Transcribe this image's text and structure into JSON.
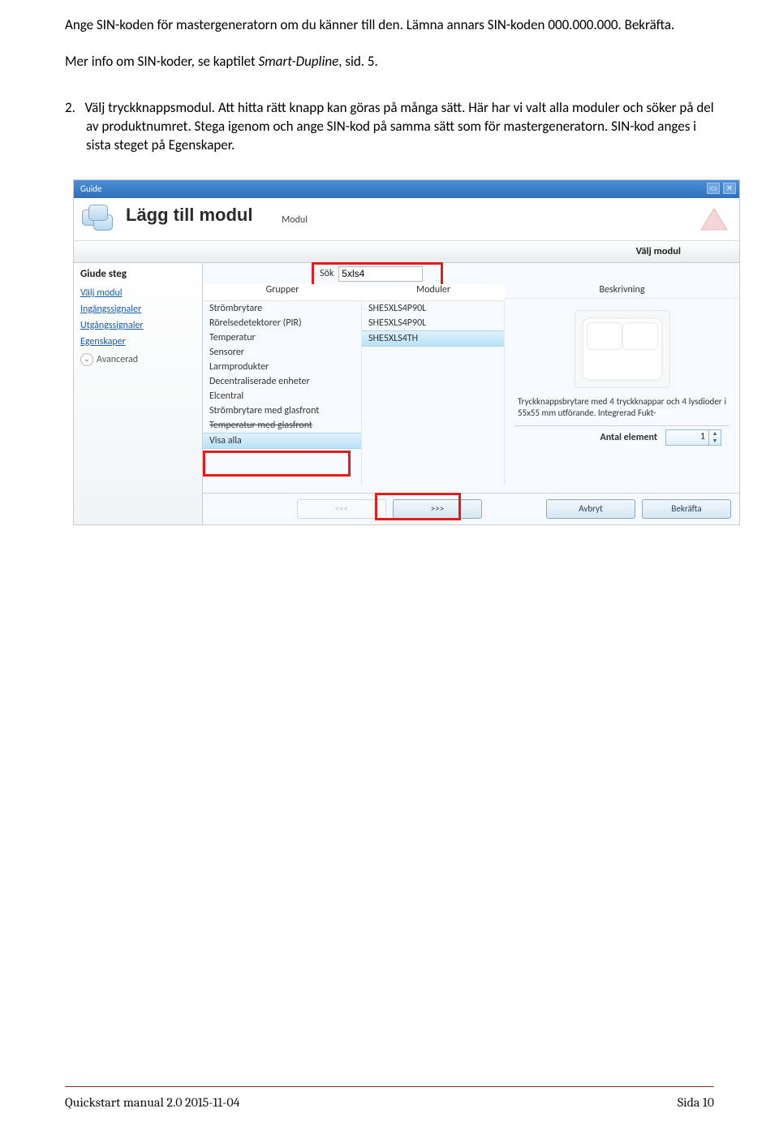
{
  "doc": {
    "p1": "Ange SIN-koden för mastergeneratorn om du känner till den. Lämna annars SIN-koden 000.000.000. Bekräfta.",
    "p2a": "Mer info om SIN-koder, se kaptilet ",
    "p2_italic": "Smart-Dupline",
    "p2b": ", sid. 5.",
    "list_num": "2.",
    "list_text": "Välj tryckknappsmodul. Att hitta rätt knapp kan göras på många sätt. Här har vi valt alla moduler och söker på del av produktnumret. Stega igenom och ange SIN-kod på samma sätt som för mastergeneratorn. SIN-kod anges i sista steget på Egenskaper."
  },
  "shot": {
    "titlebar": "Guide",
    "big_title": "Lägg till modul",
    "sub": "Modul",
    "banner": "Välj modul",
    "sidebar": {
      "title": "Giude steg",
      "links": [
        "Välj modul",
        "Ingångssignaler",
        "Utgångssignaler",
        "Egenskaper"
      ],
      "advanced": "Avancerad"
    },
    "search_label": "Sök",
    "search_value": "5xls4",
    "col_groups_header": "Grupper",
    "col_modules_header": "Moduler",
    "col_desc_header": "Beskrivning",
    "groups": [
      "Strömbrytare",
      "Rörelsedetektorer (PIR)",
      "Temperatur",
      "Sensorer",
      "Larmprodukter",
      "Decentraliserade enheter",
      "Elcentral",
      "Strömbrytare med glasfront"
    ],
    "groups_strike": "Temperatur med glasfront",
    "groups_selected": "Visa alla",
    "modules": [
      "SHE5XLS4P90L",
      "SHE5XLS4P90L"
    ],
    "modules_selected": "SHE5XLS4TH",
    "desc_text": "Tryckknappsbrytare med 4 tryckknappar och 4 lysdioder i 55x55 mm utförande. Integrerad Fukt-",
    "antal_label": "Antal element",
    "antal_value": "1",
    "btn_prev": "<<<",
    "btn_next": ">>>",
    "btn_cancel": "Avbryt",
    "btn_confirm": "Bekräfta"
  },
  "footer": {
    "left": "Quickstart manual 2.0 2015-11-04",
    "right": "Sida 10"
  }
}
